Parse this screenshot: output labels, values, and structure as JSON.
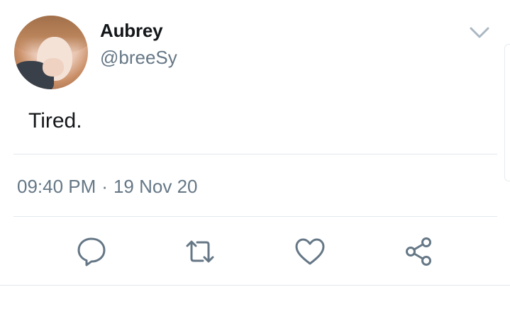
{
  "tweet": {
    "display_name": "Aubrey",
    "handle": "@breeSy",
    "text": "Tired.",
    "time": "09:40 PM",
    "separator": "·",
    "date": "19 Nov 20"
  },
  "icons": {
    "menu": "chevron-down-icon",
    "reply": "reply-icon",
    "retweet": "retweet-icon",
    "like": "heart-icon",
    "share": "share-icon"
  },
  "colors": {
    "text_primary": "#14171a",
    "text_secondary": "#657786",
    "icon": "#657786",
    "divider": "#e1e8ed"
  }
}
